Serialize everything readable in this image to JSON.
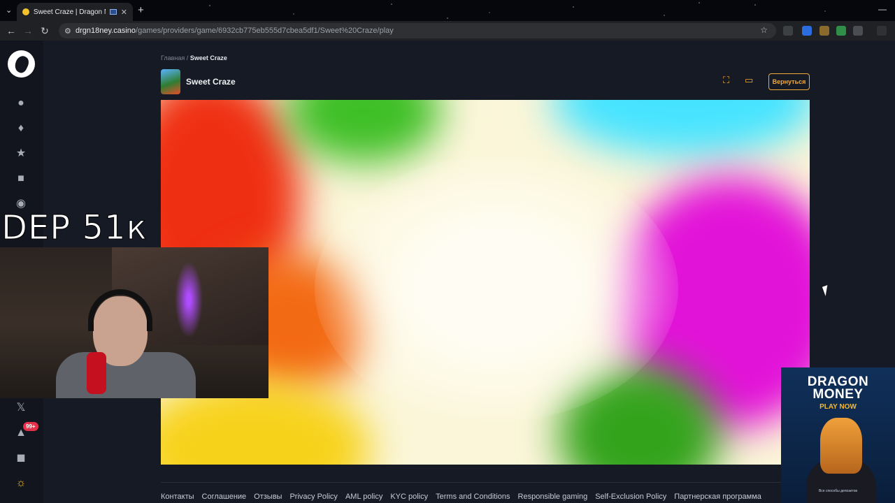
{
  "browser": {
    "tab_title": "Sweet Craze | Dragon Money",
    "url_host": "drgn18ney.casino",
    "url_path": "/games/providers/game/6932cb775eb555d7cbea5df1/Sweet%20Craze/play"
  },
  "breadcrumb": {
    "home": "Главная",
    "separator": "/",
    "current": "Sweet Craze"
  },
  "game": {
    "title": "Sweet Craze",
    "back_label": "Вернуться"
  },
  "sidebar": {
    "notification_badge": "99+"
  },
  "footer": {
    "links": [
      "Контакты",
      "Соглашение",
      "Отзывы",
      "Privacy Policy",
      "AML policy",
      "KYC policy",
      "Terms and Conditions",
      "Responsible gaming",
      "Self-Exclusion Policy",
      "Партнерская программа"
    ]
  },
  "overlay": {
    "dep_text": "DEP 51к"
  },
  "ad": {
    "title_line1": "DRAGON",
    "title_line2": "MONEY",
    "cta": "PLAY NOW",
    "small": "Все способы депозитов"
  },
  "colors": {
    "accent": "#f2a93b",
    "badge": "#e5304a",
    "background": "#161a24"
  }
}
